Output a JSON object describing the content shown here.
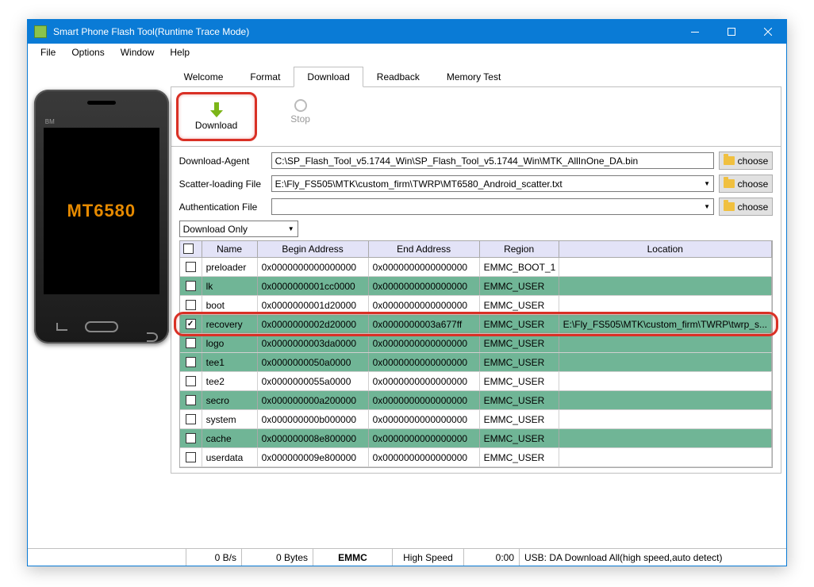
{
  "window": {
    "title": "Smart Phone Flash Tool(Runtime Trace Mode)"
  },
  "menu": {
    "file": "File",
    "options": "Options",
    "window": "Window",
    "help": "Help"
  },
  "phone": {
    "brand": "BM",
    "chip": "MT6580"
  },
  "tabs": {
    "welcome": "Welcome",
    "format": "Format",
    "download": "Download",
    "readback": "Readback",
    "memtest": "Memory Test"
  },
  "toolbar": {
    "download": "Download",
    "stop": "Stop"
  },
  "form": {
    "da_label": "Download-Agent",
    "da_value": "C:\\SP_Flash_Tool_v5.1744_Win\\SP_Flash_Tool_v5.1744_Win\\MTK_AllInOne_DA.bin",
    "scatter_label": "Scatter-loading File",
    "scatter_value": "E:\\Fly_FS505\\MTK\\custom_firm\\TWRP\\MT6580_Android_scatter.txt",
    "auth_label": "Authentication File",
    "auth_value": "",
    "choose": "choose",
    "mode": "Download Only"
  },
  "grid": {
    "headers": {
      "name": "Name",
      "begin": "Begin Address",
      "end": "End Address",
      "region": "Region",
      "location": "Location"
    },
    "rows": [
      {
        "checked": false,
        "green": false,
        "name": "preloader",
        "begin": "0x0000000000000000",
        "end": "0x0000000000000000",
        "region": "EMMC_BOOT_1",
        "location": ""
      },
      {
        "checked": false,
        "green": true,
        "name": "lk",
        "begin": "0x0000000001cc0000",
        "end": "0x0000000000000000",
        "region": "EMMC_USER",
        "location": ""
      },
      {
        "checked": false,
        "green": false,
        "name": "boot",
        "begin": "0x0000000001d20000",
        "end": "0x0000000000000000",
        "region": "EMMC_USER",
        "location": ""
      },
      {
        "checked": true,
        "green": true,
        "name": "recovery",
        "begin": "0x0000000002d20000",
        "end": "0x0000000003a677ff",
        "region": "EMMC_USER",
        "location": "E:\\Fly_FS505\\MTK\\custom_firm\\TWRP\\twrp_s...",
        "highlight": true
      },
      {
        "checked": false,
        "green": true,
        "name": "logo",
        "begin": "0x0000000003da0000",
        "end": "0x0000000000000000",
        "region": "EMMC_USER",
        "location": ""
      },
      {
        "checked": false,
        "green": true,
        "name": "tee1",
        "begin": "0x0000000050a0000",
        "end": "0x0000000000000000",
        "region": "EMMC_USER",
        "location": ""
      },
      {
        "checked": false,
        "green": false,
        "name": "tee2",
        "begin": "0x0000000055a0000",
        "end": "0x0000000000000000",
        "region": "EMMC_USER",
        "location": ""
      },
      {
        "checked": false,
        "green": true,
        "name": "secro",
        "begin": "0x000000000a200000",
        "end": "0x0000000000000000",
        "region": "EMMC_USER",
        "location": ""
      },
      {
        "checked": false,
        "green": false,
        "name": "system",
        "begin": "0x000000000b000000",
        "end": "0x0000000000000000",
        "region": "EMMC_USER",
        "location": ""
      },
      {
        "checked": false,
        "green": true,
        "name": "cache",
        "begin": "0x000000008e800000",
        "end": "0x0000000000000000",
        "region": "EMMC_USER",
        "location": ""
      },
      {
        "checked": false,
        "green": false,
        "name": "userdata",
        "begin": "0x000000009e800000",
        "end": "0x0000000000000000",
        "region": "EMMC_USER",
        "location": ""
      }
    ]
  },
  "status": {
    "rate": "0 B/s",
    "bytes": "0 Bytes",
    "storage": "EMMC",
    "speed": "High Speed",
    "time": "0:00",
    "usb": "USB: DA Download All(high speed,auto detect)"
  }
}
